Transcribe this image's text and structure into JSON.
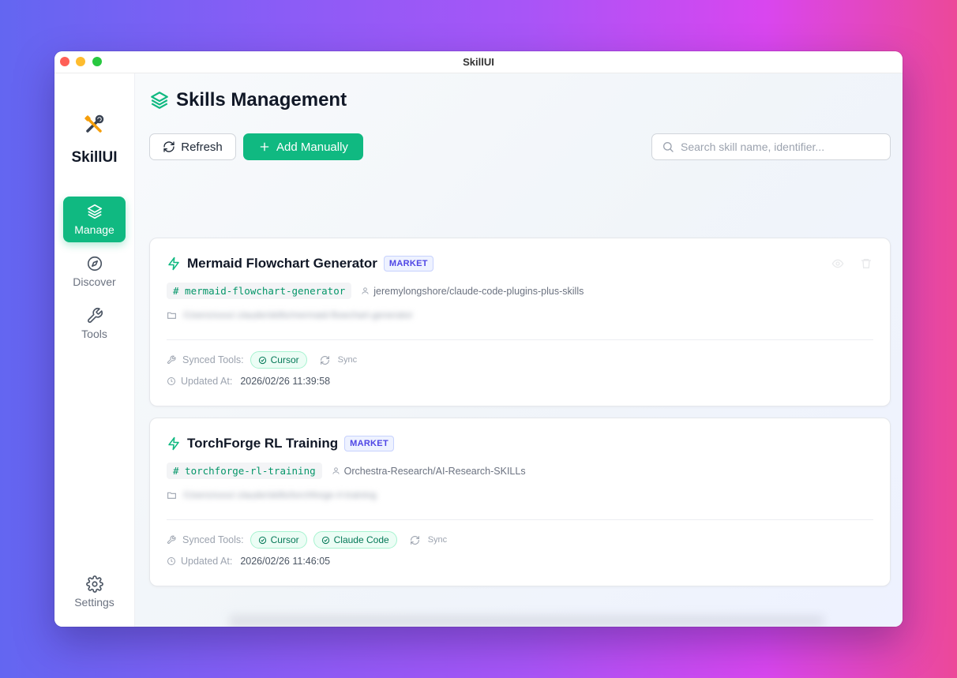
{
  "window": {
    "title": "SkillUI"
  },
  "sidebar": {
    "app_name": "SkillUI",
    "items": [
      {
        "label": "Manage",
        "icon": "layers-icon",
        "active": true
      },
      {
        "label": "Discover",
        "icon": "compass-icon",
        "active": false
      },
      {
        "label": "Tools",
        "icon": "wrench-icon",
        "active": false
      }
    ],
    "settings_label": "Settings"
  },
  "main": {
    "title": "Skills Management",
    "refresh_label": "Refresh",
    "add_label": "Add Manually",
    "search_placeholder": "Search skill name, identifier...",
    "labels": {
      "synced_tools": "Synced Tools:",
      "sync": "Sync",
      "updated_at": "Updated At:"
    },
    "skills": [
      {
        "name": "Mermaid Flowchart Generator",
        "badge": "MARKET",
        "identifier": "# mermaid-flowchart-generator",
        "author": "jeremylongshore/claude-code-plugins-plus-skills",
        "path": "/Users/xxxx/.claude/skills/mermaid-flowchart-generator",
        "tools": [
          "Cursor"
        ],
        "updated_at": "2026/02/26 11:39:58"
      },
      {
        "name": "TorchForge RL Training",
        "badge": "MARKET",
        "identifier": "# torchforge-rl-training",
        "author": "Orchestra-Research/AI-Research-SKILLs",
        "path": "/Users/xxxx/.claude/skills/torchforge-rl-training",
        "tools": [
          "Cursor",
          "Claude Code"
        ],
        "updated_at": "2026/02/26 11:46:05"
      }
    ]
  },
  "colors": {
    "accent": "#10b981",
    "market_badge": "#4f46e5"
  }
}
